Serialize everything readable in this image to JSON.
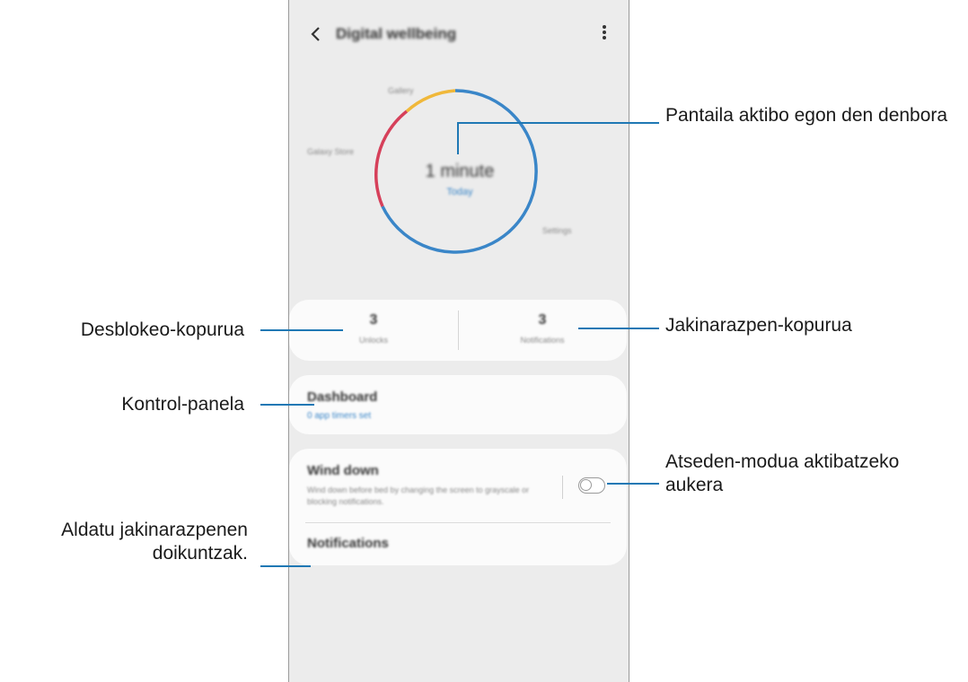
{
  "phone": {
    "title": "Digital wellbeing",
    "back_icon": "chevron-left-icon",
    "more_icon": "more-vertical-icon",
    "ring": {
      "labels": {
        "top": "Gallery",
        "left": "Galaxy Store",
        "right": "Settings"
      },
      "center_time": "1 minute",
      "center_sub": "Today",
      "colors": {
        "blue": "#3a86c8",
        "red": "#d6405a",
        "yellow": "#f0b83a"
      }
    },
    "stats": {
      "unlocks_value": "3",
      "unlocks_label": "Unlocks",
      "notifications_value": "3",
      "notifications_label": "Notifications"
    },
    "dashboard": {
      "title": "Dashboard",
      "subtitle": "0 app timers set"
    },
    "wind_down": {
      "title": "Wind down",
      "description": "Wind down before bed by changing the screen to grayscale or blocking notifications.",
      "toggle_on": false
    },
    "notifications_item": "Notifications"
  },
  "annotations": {
    "screen_time": "Pantaila aktibo egon den denbora",
    "unlocks": "Desblokeo-kopurua",
    "notifications_count": "Jakinarazpen-kopurua",
    "dashboard": "Kontrol-panela",
    "wind_down": "Atseden-modua aktibatzeko aukera",
    "notification_settings": "Aldatu jakinarazpenen doikuntzak."
  },
  "accent_color": "#1f78b4"
}
